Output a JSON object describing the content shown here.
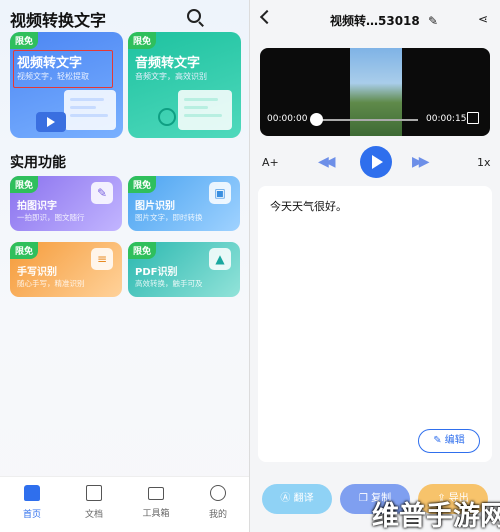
{
  "left": {
    "app_title": "视频转换文字",
    "cards": [
      {
        "badge": "限免",
        "title": "视频转文字",
        "subtitle": "视频文字，轻松提取"
      },
      {
        "badge": "限免",
        "title": "音频转文字",
        "subtitle": "音频文字，高效识别"
      }
    ],
    "section_title": "实用功能",
    "tools": [
      {
        "badge": "限免",
        "title": "拍图识字",
        "subtitle": "一拍即识，图文随行",
        "icon": "photo-text-icon"
      },
      {
        "badge": "限免",
        "title": "图片识别",
        "subtitle": "图片文字，即时转换",
        "icon": "image-icon"
      },
      {
        "badge": "限免",
        "title": "手写识别",
        "subtitle": "随心手写，精准识别",
        "icon": "handwriting-icon"
      },
      {
        "badge": "限免",
        "title": "PDF识别",
        "subtitle": "高效转换，触手可及",
        "icon": "pdf-icon"
      }
    ],
    "nav": [
      {
        "label": "首页",
        "active": true
      },
      {
        "label": "文档",
        "active": false
      },
      {
        "label": "工具箱",
        "active": false
      },
      {
        "label": "我的",
        "active": false
      }
    ]
  },
  "right": {
    "file_title": "视频转…53018",
    "player": {
      "current_time": "00:00:00",
      "total_time": "00:00:15",
      "progress": 0.0
    },
    "font_size_label": "A+",
    "speed_label": "1x",
    "transcript": "今天天气很好。",
    "edit_label": "编辑",
    "actions": {
      "translate": "翻译",
      "copy": "复制",
      "export": "导出"
    }
  },
  "watermark": "维普手游网",
  "colors": {
    "accent": "#2f6fed",
    "badge": "#2fbf5c",
    "highlight": "#e53935"
  }
}
